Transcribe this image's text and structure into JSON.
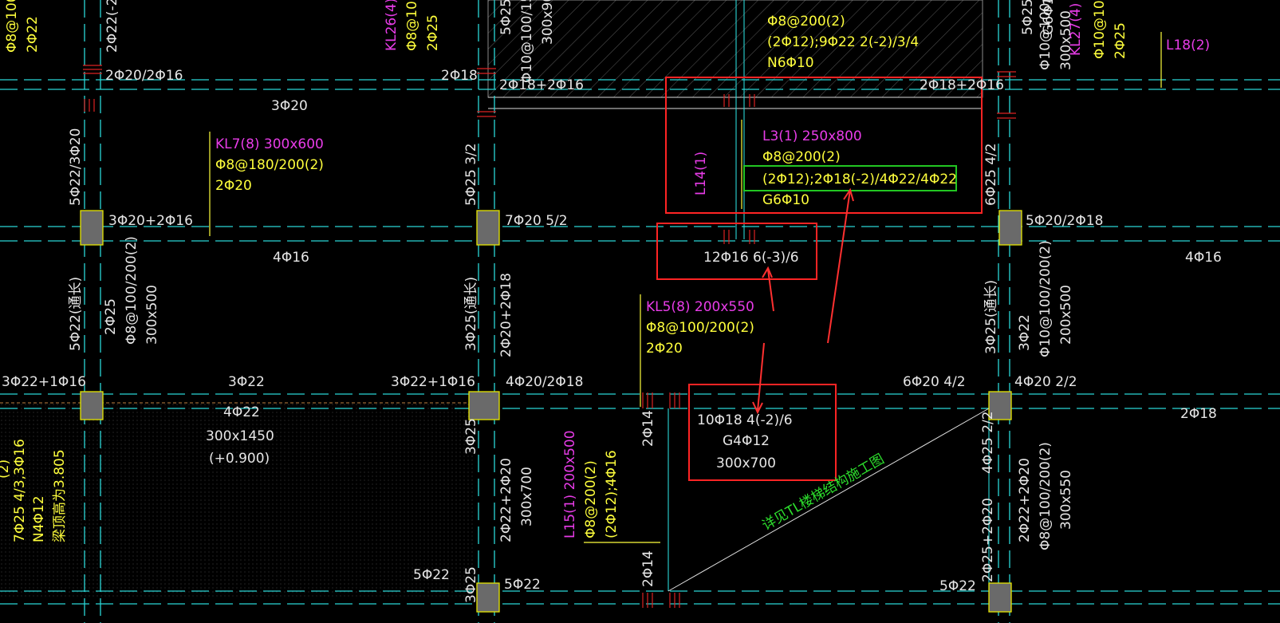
{
  "labels": {
    "kl7_name": "KL7(8) 300x600",
    "kl7_stirrup": "Φ8@180/200(2)",
    "kl7_top": "2Φ20",
    "kl5_name": "KL5(8) 200x550",
    "kl5_stirrup": "Φ8@100/200(2)",
    "kl5_top": "2Φ20",
    "l3_name": "L3(1) 250x800",
    "l3_stirrup": "Φ8@200(2)",
    "l3_bars": "(2Φ12);2Φ18(-2)/4Φ22/4Φ22",
    "l3_side": "G6Φ10",
    "l14_name": "L14(1)",
    "l15_name": "L15(1) 200x500",
    "l15_stirrup": "Φ8@200(2)",
    "l15_bars": "(2Φ12);4Φ16",
    "l18_name": "L18(2)",
    "kl26_name": "KL26(4)",
    "kl27_name": "KL27(4)",
    "top_l_stirrup": "Φ8@200(2)",
    "top_l_bars": "(2Φ12);9Φ22 2(-2)/3/4",
    "top_l_side": "N6Φ10",
    "b_2020_2016": "2Φ20/2Φ16",
    "b_3020": "3Φ20",
    "b_2018_top": "2Φ18",
    "b_2018_2016_a": "2Φ18+2Φ16",
    "b_2018_2016_b": "2Φ18+2Φ16",
    "b_3020_2016": "3Φ20+2Φ16",
    "b_7020": "7Φ20 5/2",
    "b_5020_2018": "5Φ20/2Φ18",
    "b_4016_left": "4Φ16",
    "b_12016": "12Φ16 6(-3)/6",
    "b_4016_right": "4Φ16",
    "b_3022_1016_a": "3Φ22+1Φ16",
    "b_3022": "3Φ22",
    "b_3022_1016_b": "3Φ22+1Φ16",
    "b_4020_2018": "4Φ20/2Φ18",
    "b_6020": "6Φ20 4/2",
    "b_4020_22": "4Φ20 2/2",
    "b_4022": "4Φ22",
    "b_300x1450": "300x1450",
    "b_elev": "(+0.900)",
    "b_2018_right": "2Φ18",
    "b_10018": "10Φ18 4(-2)/6",
    "b_g4": "G4Φ12",
    "b_300x700": "300x700",
    "b_5022_a": "5Φ22",
    "b_5022_b": "5Φ22",
    "b_5022_c": "5Φ22",
    "stair_note": "详见TL楼梯结构施工图",
    "v_5022_3020": "5Φ22/3Φ20",
    "v_5025_32": "5Φ25 3/2",
    "v_6025_42": "6Φ25 4/2",
    "v_5022_tc": "5Φ22(通长)",
    "v_2025": "2Φ25",
    "v_st_100_200": "Φ8@100/200(2)",
    "v_300x500": "300x500",
    "v_3025_tc": "3Φ25(通长)",
    "v_2020_2018": "2Φ20+2Φ18",
    "v_3025_tc_r": "3Φ25(通长)",
    "v_3022": "3Φ22",
    "v_st_10": "Φ10@100/200(2)",
    "v_200x500": "200x500",
    "v_st_10_r": "Φ10@100/200(2)",
    "v_300x500_r": "300x500",
    "v_3025_a": "3Φ25",
    "v_2022_2020": "2Φ22+2Φ20",
    "v_300x700": "300x700",
    "v_3025_b": "3Φ25",
    "v_2014_a": "2Φ14",
    "v_2014_b": "2Φ14",
    "v_4025_22": "4Φ25 2/2",
    "v_2025_2020": "2Φ25+2Φ20",
    "v_2022_2020_r": "2Φ22+2Φ20",
    "v_st_8_r": "Φ8@100/200(2)",
    "v_300x550": "300x550",
    "v_top_5025": "5Φ25",
    "v_top_st": "Φ10@100/150",
    "v_top_300x9": "300x90",
    "v_top_g6": "G6Φ10",
    "v_top_5025_r": "5Φ25",
    "v_top_l10": "Φ10@100/",
    "v_top_2025": "2Φ25",
    "v_top_l8": "Φ8@100",
    "v_top_2022": "2Φ22",
    "v_top_2022_2": "2Φ22(-2)",
    "v_top_kl26_st": "Φ8@100/",
    "v_top_kl26_b": "2Φ25",
    "v_left_1": "7Φ25 4/3,3Φ16",
    "v_left_2": "N4Φ12",
    "v_left_3": "梁顶高为3.805",
    "v_left_0": "(2)"
  },
  "colors": {
    "yellow": "#ffff3c",
    "white": "#e6e6e6",
    "magenta": "#e83ce8",
    "green": "#2de02d",
    "cyan": "#2ad7d7",
    "red": "#ff2424",
    "column_fill": "#6a6a6a"
  }
}
